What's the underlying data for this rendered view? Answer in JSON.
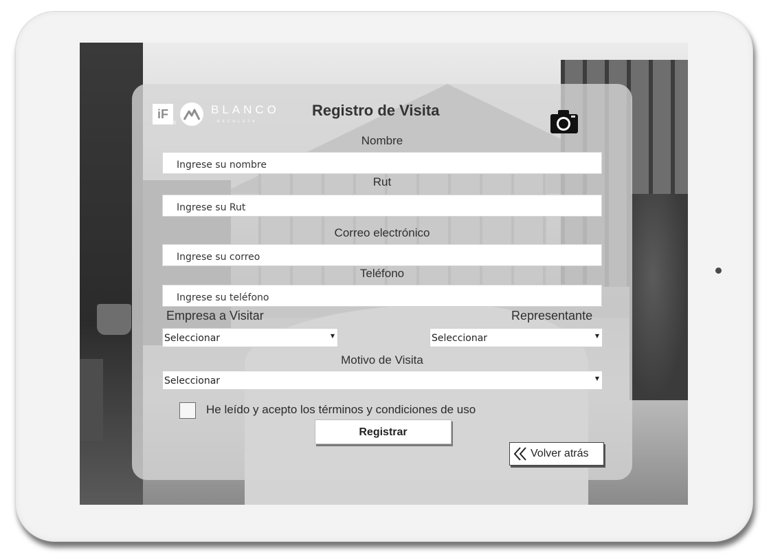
{
  "app": {
    "logo_if": "iF",
    "logo_r": "®",
    "logo_word": "BLANCO",
    "logo_sub": "RECOLETA",
    "title": "Registro de Visita",
    "camera_icon": "camera-icon"
  },
  "form": {
    "nombre_label": "Nombre",
    "nombre_placeholder": "Ingrese su nombre",
    "rut_label": "Rut",
    "rut_placeholder": "Ingrese su Rut",
    "correo_label": "Correo electrónico",
    "correo_placeholder": "Ingrese su correo",
    "telefono_label": "Teléfono",
    "telefono_placeholder": "Ingrese su teléfono",
    "empresa_label": "Empresa a Visitar",
    "empresa_value": "Seleccionar",
    "representante_label": "Representante",
    "representante_value": "Seleccionar",
    "motivo_label": "Motivo de Visita",
    "motivo_value": "Seleccionar",
    "dropdown_arrow": "▼",
    "terms_text": "He leído y acepto los términos y condiciones de uso",
    "terms_checked": false,
    "submit_label": "Registrar",
    "back_label": "Volver atrás"
  },
  "colors": {
    "panel": "#d6d6d6",
    "title": "#333333",
    "field_bg": "#ffffff"
  }
}
